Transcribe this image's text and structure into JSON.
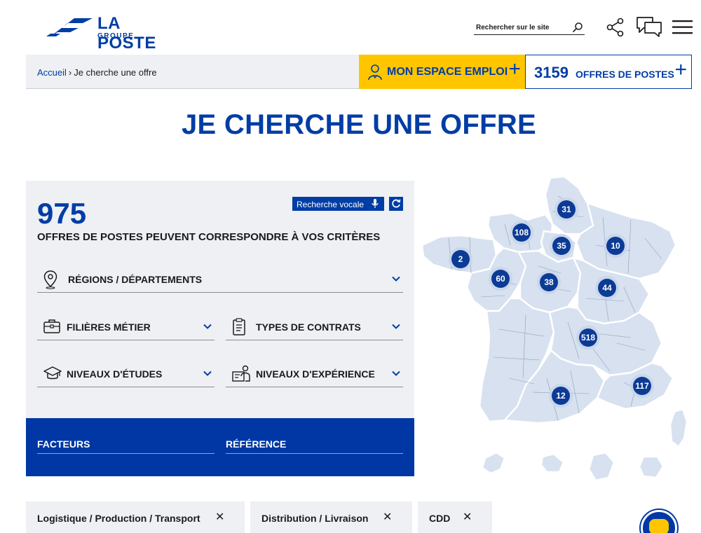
{
  "header": {
    "logo_main": "LA POSTE",
    "logo_sub": "GROUPE",
    "search_placeholder": "Rechercher sur le site",
    "icons": [
      "search-icon",
      "share-icon",
      "chat-icon",
      "menu-icon"
    ]
  },
  "breadcrumb": {
    "home": "Accueil",
    "separator": "›",
    "current": "Je cherche une offre"
  },
  "cta": {
    "emploi_label": "MON ESPACE EMPLOI",
    "plus": "+",
    "offres_count": "3159",
    "offres_label": "OFFRES DE POSTES"
  },
  "page_title": "JE CHERCHE UNE OFFRE",
  "results": {
    "count": "975",
    "subtitle": "OFFRES DE POSTES PEUVENT CORRESPONDRE À VOS CRITÈRES",
    "voice_label": "Recherche vocale"
  },
  "filters": {
    "regions": "RÉGIONS / DÉPARTEMENTS",
    "filieres": "FILIÈRES MÉTIER",
    "contrats": "TYPES DE CONTRATS",
    "etudes": "NIVEAUX D'ÉTUDES",
    "experience": "NIVEAUX D'EXPÉRIENCE"
  },
  "blue_fields": {
    "facteurs": "FACTEURS",
    "reference": "RÉFÉRENCE"
  },
  "map_clusters": [
    {
      "label": "31"
    },
    {
      "label": "108"
    },
    {
      "label": "35"
    },
    {
      "label": "10"
    },
    {
      "label": "2"
    },
    {
      "label": "60"
    },
    {
      "label": "38"
    },
    {
      "label": "44"
    },
    {
      "label": "518"
    },
    {
      "label": "117"
    },
    {
      "label": "12"
    }
  ],
  "tags": [
    {
      "label": "Logistique / Production / Transport",
      "remove": "✕"
    },
    {
      "label": "Distribution / Livraison",
      "remove": "✕"
    },
    {
      "label": "CDD",
      "remove": "✕"
    }
  ],
  "colors": {
    "brand_blue": "#003da5",
    "accent_yellow": "#ffc600",
    "panel_bg": "#eef0f4",
    "map_fill": "#d7e1ef"
  }
}
